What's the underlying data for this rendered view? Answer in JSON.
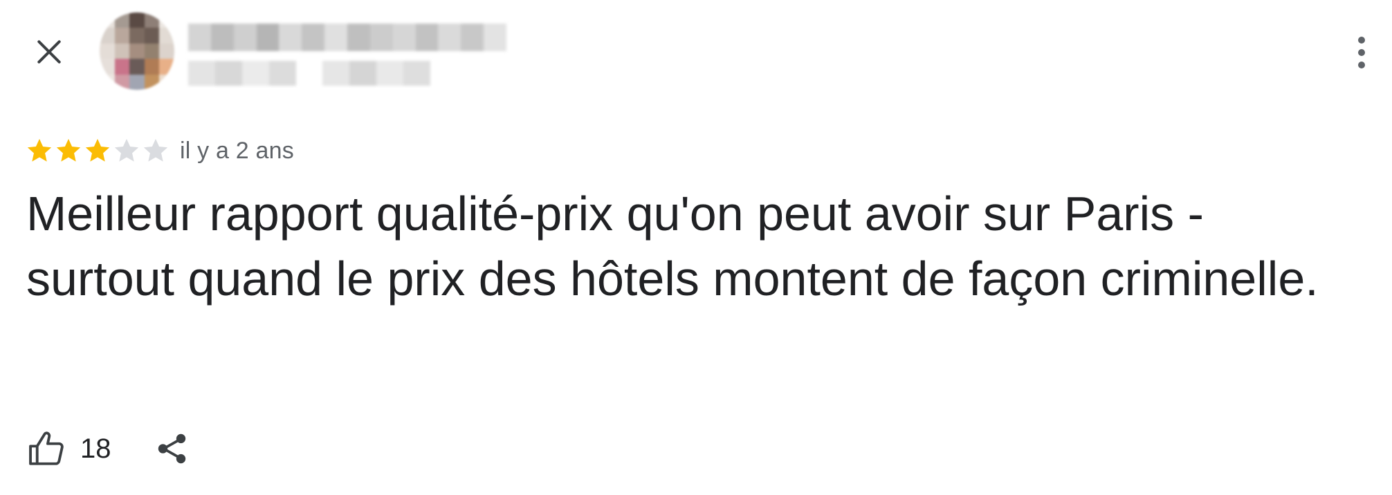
{
  "header": {
    "close_icon": "close-icon",
    "more_icon": "more-vertical-icon",
    "reviewer_name": "",
    "reviewer_meta": ""
  },
  "review": {
    "rating": 3,
    "max_rating": 5,
    "time_ago": "il y a 2 ans",
    "text": "Meilleur rapport qualité-prix qu'on peut avoir sur Paris - surtout quand le prix des hôtels montent de façon criminelle."
  },
  "actions": {
    "like_icon": "thumb-up-icon",
    "like_count": "18",
    "share_icon": "share-icon"
  },
  "colors": {
    "star_filled": "#FBBC04",
    "star_empty": "#DADCE0",
    "text_primary": "#202124",
    "text_secondary": "#5F6368",
    "icon": "#3C4043"
  }
}
